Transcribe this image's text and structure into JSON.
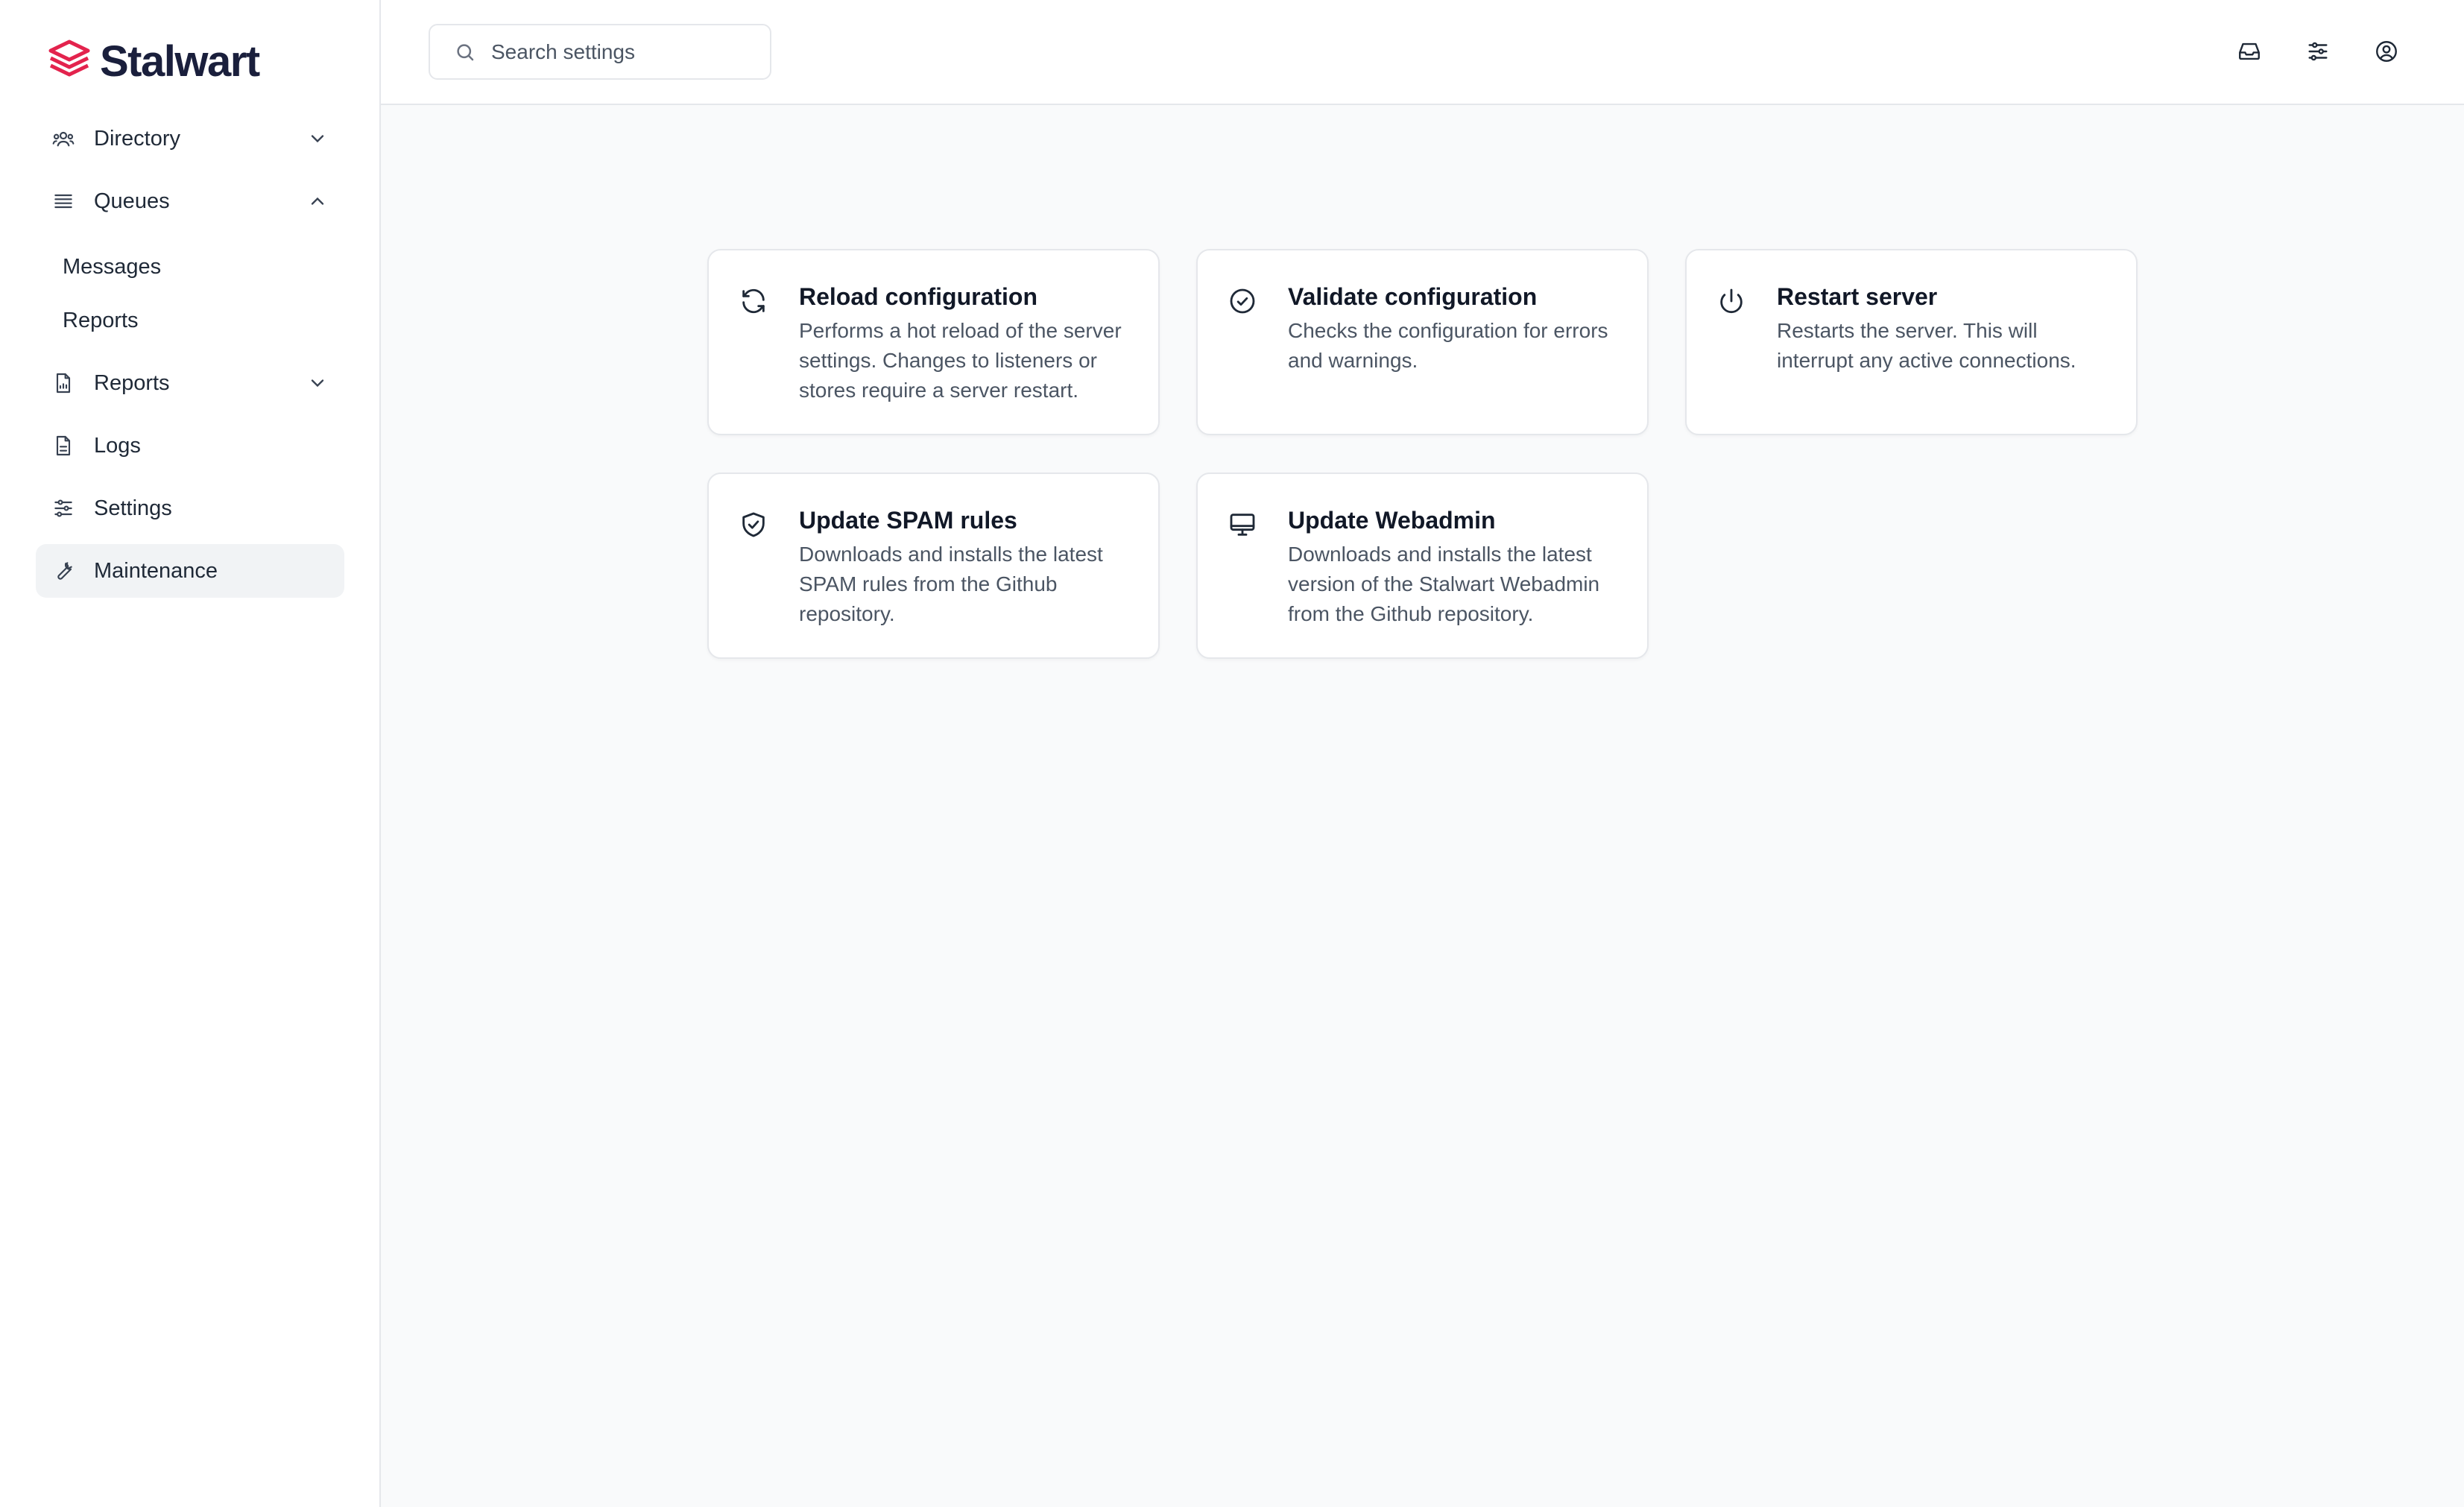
{
  "brand": {
    "name": "Stalwart",
    "accent": "#e3234d",
    "dark": "#1a1f3c"
  },
  "sidebar": {
    "items": [
      {
        "label": "Directory",
        "icon": "users-icon",
        "chevron": "down"
      },
      {
        "label": "Queues",
        "icon": "queue-icon",
        "chevron": "up",
        "children": [
          {
            "label": "Messages"
          },
          {
            "label": "Reports"
          }
        ]
      },
      {
        "label": "Reports",
        "icon": "report-icon",
        "chevron": "down"
      },
      {
        "label": "Logs",
        "icon": "document-icon"
      },
      {
        "label": "Settings",
        "icon": "sliders-icon"
      },
      {
        "label": "Maintenance",
        "icon": "wrench-icon",
        "active": true
      }
    ]
  },
  "header": {
    "search": {
      "placeholder": "Search settings",
      "value": ""
    },
    "icons": [
      "inbox-icon",
      "sliders-icon",
      "user-circle-icon"
    ]
  },
  "cards": [
    {
      "title": "Reload configuration",
      "icon": "refresh-icon",
      "description": "Performs a hot reload of the server settings. Changes to listeners or stores require a server restart."
    },
    {
      "title": "Validate configuration",
      "icon": "check-circle-icon",
      "description": "Checks the configuration for errors and warnings."
    },
    {
      "title": "Restart server",
      "icon": "power-icon",
      "description": "Restarts the server. This will interrupt any active connections."
    },
    {
      "title": "Update SPAM rules",
      "icon": "shield-check-icon",
      "description": "Downloads and installs the latest SPAM rules from the Github repository."
    },
    {
      "title": "Update Webadmin",
      "icon": "monitor-icon",
      "description": "Downloads and installs the latest version of the Stalwart Webadmin from the Github repository."
    }
  ]
}
